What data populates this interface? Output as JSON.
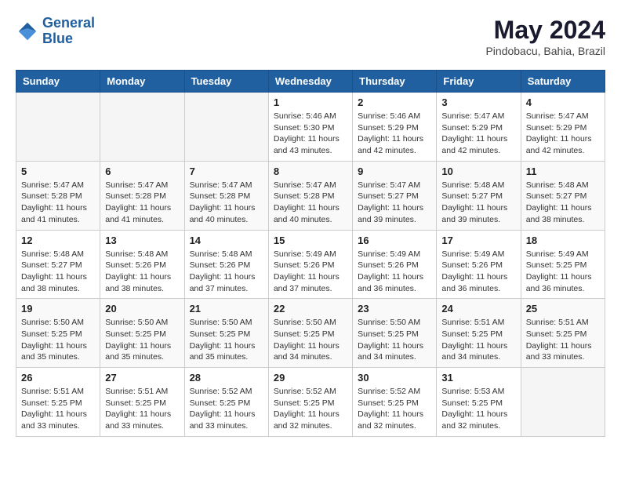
{
  "logo": {
    "line1": "General",
    "line2": "Blue"
  },
  "header": {
    "month_year": "May 2024",
    "location": "Pindobacu, Bahia, Brazil"
  },
  "weekdays": [
    "Sunday",
    "Monday",
    "Tuesday",
    "Wednesday",
    "Thursday",
    "Friday",
    "Saturday"
  ],
  "weeks": [
    [
      {
        "day": "",
        "info": ""
      },
      {
        "day": "",
        "info": ""
      },
      {
        "day": "",
        "info": ""
      },
      {
        "day": "1",
        "info": "Sunrise: 5:46 AM\nSunset: 5:30 PM\nDaylight: 11 hours\nand 43 minutes."
      },
      {
        "day": "2",
        "info": "Sunrise: 5:46 AM\nSunset: 5:29 PM\nDaylight: 11 hours\nand 42 minutes."
      },
      {
        "day": "3",
        "info": "Sunrise: 5:47 AM\nSunset: 5:29 PM\nDaylight: 11 hours\nand 42 minutes."
      },
      {
        "day": "4",
        "info": "Sunrise: 5:47 AM\nSunset: 5:29 PM\nDaylight: 11 hours\nand 42 minutes."
      }
    ],
    [
      {
        "day": "5",
        "info": "Sunrise: 5:47 AM\nSunset: 5:28 PM\nDaylight: 11 hours\nand 41 minutes."
      },
      {
        "day": "6",
        "info": "Sunrise: 5:47 AM\nSunset: 5:28 PM\nDaylight: 11 hours\nand 41 minutes."
      },
      {
        "day": "7",
        "info": "Sunrise: 5:47 AM\nSunset: 5:28 PM\nDaylight: 11 hours\nand 40 minutes."
      },
      {
        "day": "8",
        "info": "Sunrise: 5:47 AM\nSunset: 5:28 PM\nDaylight: 11 hours\nand 40 minutes."
      },
      {
        "day": "9",
        "info": "Sunrise: 5:47 AM\nSunset: 5:27 PM\nDaylight: 11 hours\nand 39 minutes."
      },
      {
        "day": "10",
        "info": "Sunrise: 5:48 AM\nSunset: 5:27 PM\nDaylight: 11 hours\nand 39 minutes."
      },
      {
        "day": "11",
        "info": "Sunrise: 5:48 AM\nSunset: 5:27 PM\nDaylight: 11 hours\nand 38 minutes."
      }
    ],
    [
      {
        "day": "12",
        "info": "Sunrise: 5:48 AM\nSunset: 5:27 PM\nDaylight: 11 hours\nand 38 minutes."
      },
      {
        "day": "13",
        "info": "Sunrise: 5:48 AM\nSunset: 5:26 PM\nDaylight: 11 hours\nand 38 minutes."
      },
      {
        "day": "14",
        "info": "Sunrise: 5:48 AM\nSunset: 5:26 PM\nDaylight: 11 hours\nand 37 minutes."
      },
      {
        "day": "15",
        "info": "Sunrise: 5:49 AM\nSunset: 5:26 PM\nDaylight: 11 hours\nand 37 minutes."
      },
      {
        "day": "16",
        "info": "Sunrise: 5:49 AM\nSunset: 5:26 PM\nDaylight: 11 hours\nand 36 minutes."
      },
      {
        "day": "17",
        "info": "Sunrise: 5:49 AM\nSunset: 5:26 PM\nDaylight: 11 hours\nand 36 minutes."
      },
      {
        "day": "18",
        "info": "Sunrise: 5:49 AM\nSunset: 5:25 PM\nDaylight: 11 hours\nand 36 minutes."
      }
    ],
    [
      {
        "day": "19",
        "info": "Sunrise: 5:50 AM\nSunset: 5:25 PM\nDaylight: 11 hours\nand 35 minutes."
      },
      {
        "day": "20",
        "info": "Sunrise: 5:50 AM\nSunset: 5:25 PM\nDaylight: 11 hours\nand 35 minutes."
      },
      {
        "day": "21",
        "info": "Sunrise: 5:50 AM\nSunset: 5:25 PM\nDaylight: 11 hours\nand 35 minutes."
      },
      {
        "day": "22",
        "info": "Sunrise: 5:50 AM\nSunset: 5:25 PM\nDaylight: 11 hours\nand 34 minutes."
      },
      {
        "day": "23",
        "info": "Sunrise: 5:50 AM\nSunset: 5:25 PM\nDaylight: 11 hours\nand 34 minutes."
      },
      {
        "day": "24",
        "info": "Sunrise: 5:51 AM\nSunset: 5:25 PM\nDaylight: 11 hours\nand 34 minutes."
      },
      {
        "day": "25",
        "info": "Sunrise: 5:51 AM\nSunset: 5:25 PM\nDaylight: 11 hours\nand 33 minutes."
      }
    ],
    [
      {
        "day": "26",
        "info": "Sunrise: 5:51 AM\nSunset: 5:25 PM\nDaylight: 11 hours\nand 33 minutes."
      },
      {
        "day": "27",
        "info": "Sunrise: 5:51 AM\nSunset: 5:25 PM\nDaylight: 11 hours\nand 33 minutes."
      },
      {
        "day": "28",
        "info": "Sunrise: 5:52 AM\nSunset: 5:25 PM\nDaylight: 11 hours\nand 33 minutes."
      },
      {
        "day": "29",
        "info": "Sunrise: 5:52 AM\nSunset: 5:25 PM\nDaylight: 11 hours\nand 32 minutes."
      },
      {
        "day": "30",
        "info": "Sunrise: 5:52 AM\nSunset: 5:25 PM\nDaylight: 11 hours\nand 32 minutes."
      },
      {
        "day": "31",
        "info": "Sunrise: 5:53 AM\nSunset: 5:25 PM\nDaylight: 11 hours\nand 32 minutes."
      },
      {
        "day": "",
        "info": ""
      }
    ]
  ]
}
